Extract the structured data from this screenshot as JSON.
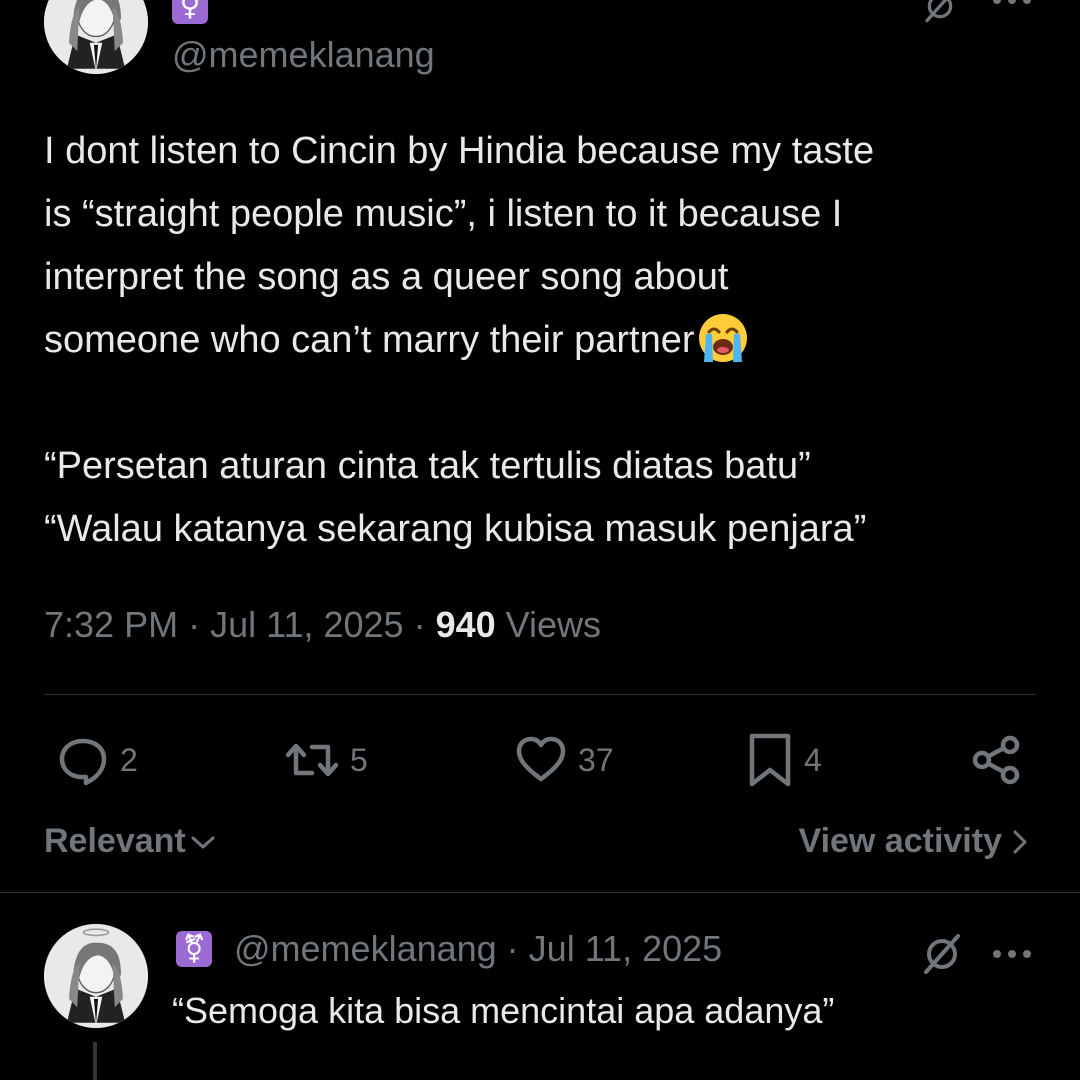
{
  "main_tweet": {
    "badge_glyph": "♀",
    "handle": "@memeklanang",
    "text_lines": [
      "I dont listen to Cincin by Hindia because my taste",
      "is “straight people music”, i listen to it because I",
      "interpret the song as a queer song about",
      "someone who can’t marry their partner",
      "",
      "“Persetan aturan cinta tak tertulis diatas batu”",
      "“Walau katanya sekarang kubisa masuk penjara”"
    ],
    "emoji": "loudly-crying-face",
    "time": "7:32 PM",
    "sep1": " · ",
    "date": "Jul 11, 2025",
    "sep2": " · ",
    "views_count": "940",
    "views_label": " Views",
    "actions": {
      "replies": "2",
      "reposts": "5",
      "likes": "37",
      "bookmarks": "4"
    }
  },
  "sort": {
    "label": "Relevant",
    "chevron": "⌄"
  },
  "view_activity": {
    "label": "View activity",
    "chevron": "›"
  },
  "reply": {
    "badge_glyph": "⚧",
    "handle": "@memeklanang",
    "sep": " · ",
    "date": "Jul 11, 2025",
    "text": "“Semoga kita bisa mencintai apa adanya”"
  },
  "colors": {
    "background": "#000000",
    "text": "#e7e9ea",
    "secondary": "#71767b",
    "divider": "#2f3336",
    "badge": "#9b6bd3"
  },
  "icons": [
    "grok-icon",
    "more-icon",
    "reply-icon",
    "repost-icon",
    "like-icon",
    "bookmark-icon",
    "share-icon",
    "chevron-down-icon",
    "chevron-right-icon"
  ]
}
